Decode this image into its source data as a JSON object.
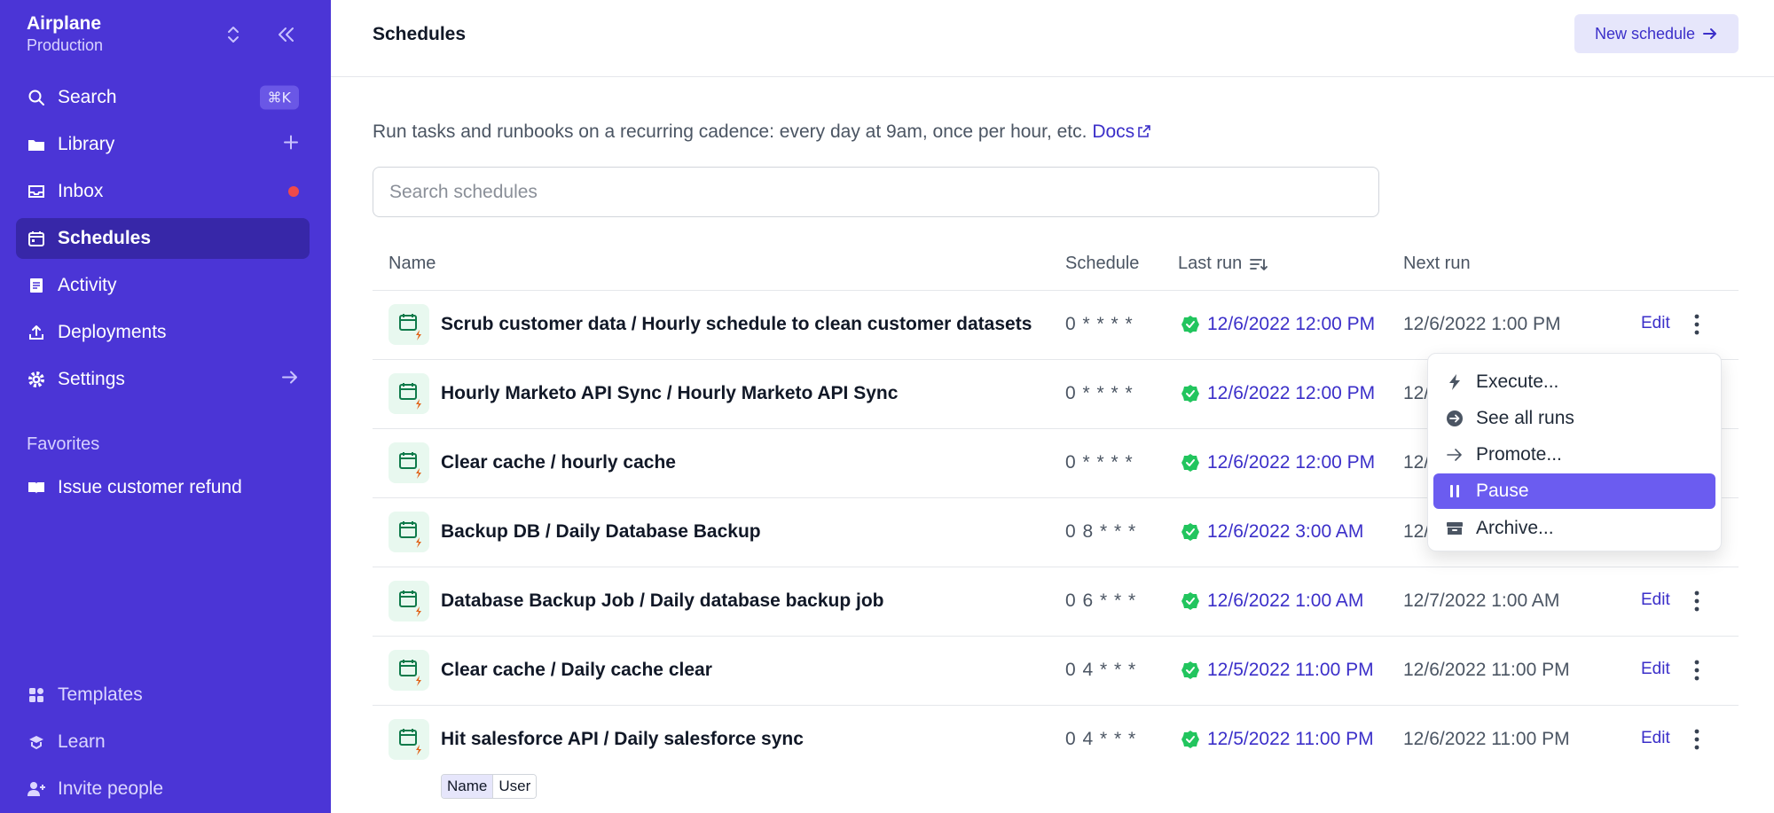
{
  "workspace": {
    "name": "Airplane",
    "env": "Production"
  },
  "sidebar": {
    "nav": [
      {
        "label": "Search",
        "shortcut": "⌘K"
      },
      {
        "label": "Library"
      },
      {
        "label": "Inbox"
      },
      {
        "label": "Schedules"
      },
      {
        "label": "Activity"
      },
      {
        "label": "Deployments"
      },
      {
        "label": "Settings"
      }
    ],
    "favorites_title": "Favorites",
    "favorites": [
      {
        "label": "Issue customer refund"
      }
    ],
    "bottom": [
      {
        "label": "Templates"
      },
      {
        "label": "Learn"
      },
      {
        "label": "Invite people"
      }
    ]
  },
  "header": {
    "title": "Schedules",
    "new_button": "New schedule"
  },
  "description": {
    "text": "Run tasks and runbooks on a recurring cadence: every day at 9am, once per hour, etc.",
    "docs_link": "Docs"
  },
  "search": {
    "placeholder": "Search schedules"
  },
  "table": {
    "columns": [
      "Name",
      "Schedule",
      "Last run",
      "Next run"
    ],
    "edit_label": "Edit",
    "rows": [
      {
        "name": "Scrub customer data / Hourly schedule to clean customer datasets",
        "schedule": "0 * * * *",
        "last_run": "12/6/2022 12:00 PM",
        "next_run": "12/6/2022 1:00 PM"
      },
      {
        "name": "Hourly Marketo API Sync / Hourly Marketo API Sync",
        "schedule": "0 * * * *",
        "last_run": "12/6/2022 12:00 PM",
        "next_run": "12/"
      },
      {
        "name": "Clear cache / hourly cache",
        "schedule": "0 * * * *",
        "last_run": "12/6/2022 12:00 PM",
        "next_run": "12/"
      },
      {
        "name": "Backup DB / Daily Database Backup",
        "schedule": "0 8 * * *",
        "last_run": "12/6/2022 3:00 AM",
        "next_run": "12/"
      },
      {
        "name": "Database Backup Job / Daily database backup job",
        "schedule": "0 6 * * *",
        "last_run": "12/6/2022 1:00 AM",
        "next_run": "12/7/2022 1:00 AM"
      },
      {
        "name": "Clear cache / Daily cache clear",
        "schedule": "0 4 * * *",
        "last_run": "12/5/2022 11:00 PM",
        "next_run": "12/6/2022 11:00 PM"
      },
      {
        "name": "Hit salesforce API / Daily salesforce sync",
        "schedule": "0 4 * * *",
        "last_run": "12/5/2022 11:00 PM",
        "next_run": "12/6/2022 11:00 PM"
      }
    ]
  },
  "tag_chips": {
    "name": "Name",
    "user": "User"
  },
  "context_menu": {
    "items": [
      "Execute...",
      "See all runs",
      "Promote...",
      "Pause",
      "Archive..."
    ],
    "highlighted": "Pause"
  },
  "colors": {
    "sidebar": "#4b35d6",
    "accent": "#3b2fc9",
    "success": "#22c55e",
    "highlight": "#6b5cf0"
  }
}
